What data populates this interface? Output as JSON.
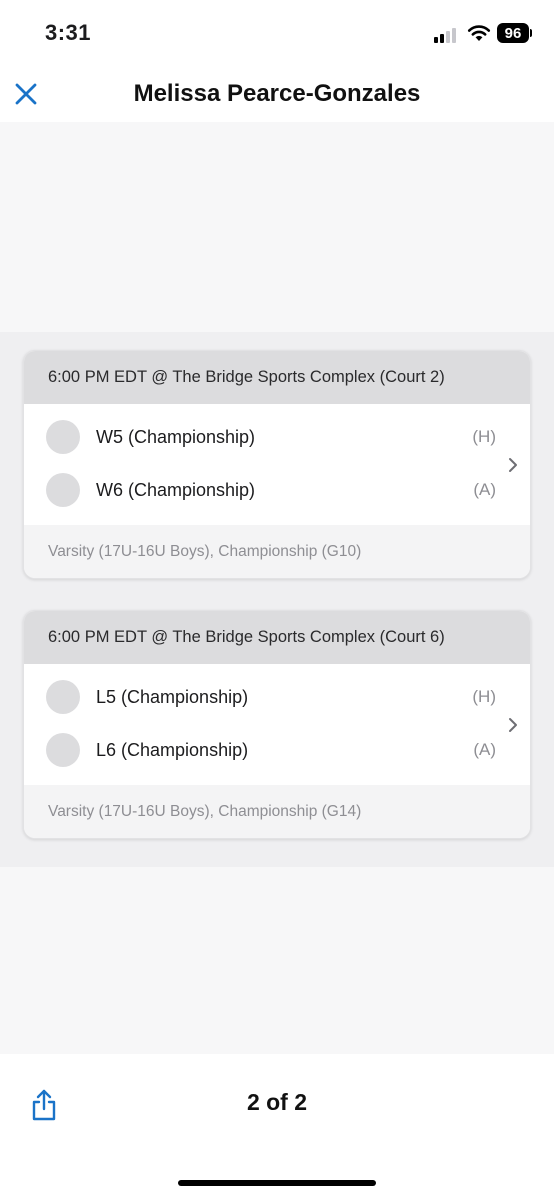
{
  "status_bar": {
    "time": "3:31",
    "battery": "96"
  },
  "header": {
    "title": "Melissa Pearce-Gonzales",
    "close_icon": "close-icon",
    "accent_color": "#1a73c8"
  },
  "games": [
    {
      "header": "6:00 PM EDT @ The Bridge Sports Complex (Court 2)",
      "home": {
        "name": "W5 (Championship)",
        "side": "(H)"
      },
      "away": {
        "name": "W6 (Championship)",
        "side": "(A)"
      },
      "footer": "Varsity (17U-16U Boys), Championship (G10)"
    },
    {
      "header": "6:00 PM EDT @ The Bridge Sports Complex (Court 6)",
      "home": {
        "name": "L5 (Championship)",
        "side": "(H)"
      },
      "away": {
        "name": "L6 (Championship)",
        "side": "(A)"
      },
      "footer": "Varsity (17U-16U Boys), Championship (G14)"
    }
  ],
  "footer": {
    "page_counter": "2 of 2",
    "share_icon": "share-icon"
  }
}
